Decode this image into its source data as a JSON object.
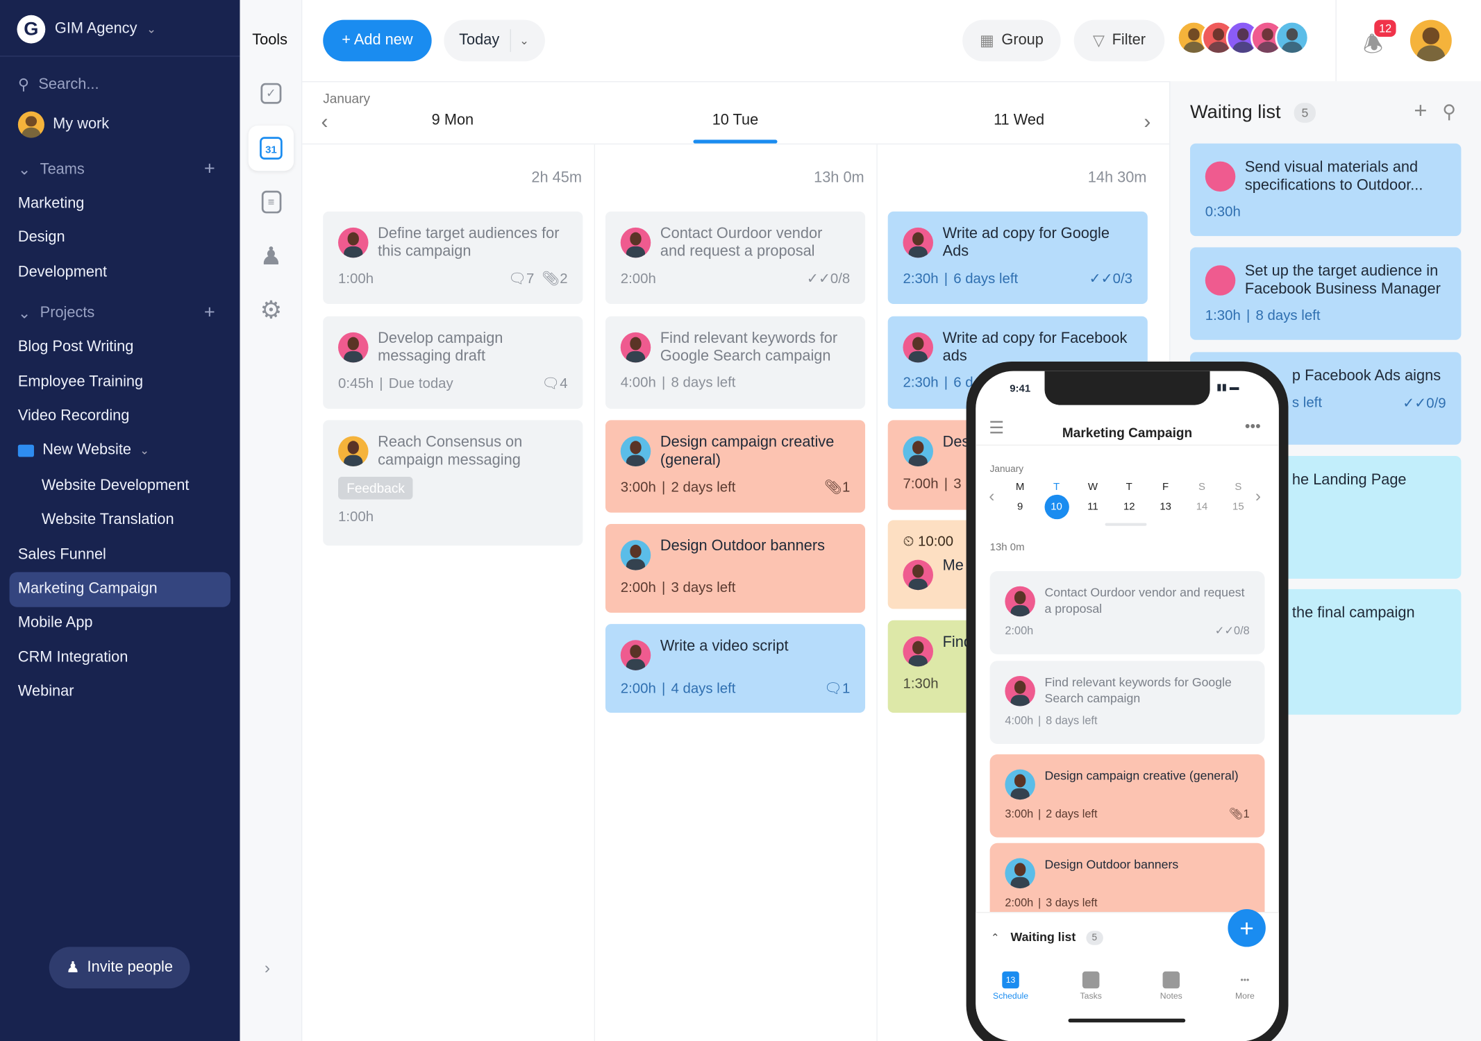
{
  "sidebar": {
    "workspace": "GIM Agency",
    "search_placeholder": "Search...",
    "my_work": "My work",
    "teams_label": "Teams",
    "teams": [
      "Marketing",
      "Design",
      "Development"
    ],
    "projects_label": "Projects",
    "projects": [
      "Blog Post Writing",
      "Employee Training",
      "Video Recording"
    ],
    "folder": "New Website",
    "folder_items": [
      "Website Development",
      "Website Translation"
    ],
    "projects_after": [
      "Sales Funnel",
      "Marketing Campaign",
      "Mobile App",
      "CRM Integration",
      "Webinar"
    ],
    "active_project": "Marketing Campaign",
    "invite": "Invite people"
  },
  "tools": {
    "label": "Tools",
    "calendar_day": "31",
    "icons": [
      "check-square-icon",
      "calendar-icon",
      "notes-icon",
      "person-icon",
      "gear-icon"
    ]
  },
  "header": {
    "add_new": "+ Add new",
    "today": "Today",
    "group": "Group",
    "filter": "Filter",
    "notification_count": "12"
  },
  "calendar": {
    "month": "January",
    "days": [
      {
        "label": "9 Mon",
        "total": "2h 45m",
        "cards": [
          {
            "title": "Define target audiences for this campaign",
            "time": "1:00h",
            "comments": "7",
            "attachments": "2",
            "color": "#f1f3f5",
            "faded": true,
            "avatar": "#ef5b8f"
          },
          {
            "title": "Develop campaign messaging draft",
            "time": "0:45h",
            "extra": "Due today",
            "comments": "4",
            "color": "#f1f3f5",
            "faded": true,
            "avatar": "#ef5b8f"
          },
          {
            "title": "Reach Consensus on campaign messaging",
            "tag": "Feedback",
            "time": "1:00h",
            "color": "#f1f3f5",
            "faded": true,
            "avatar": "#f5b33b"
          }
        ]
      },
      {
        "label": "10 Tue",
        "active": true,
        "total": "13h 0m",
        "cards": [
          {
            "title": "Contact Ourdoor vendor and request a proposal",
            "time": "2:00h",
            "checks": "0/8",
            "color": "#f1f3f5",
            "faded": true,
            "avatar": "#ef5b8f"
          },
          {
            "title": "Find relevant keywords for Google Search campaign",
            "time": "4:00h",
            "extra": "8 days left",
            "color": "#f1f3f5",
            "faded": true,
            "avatar": "#ef5b8f"
          },
          {
            "title": "Design campaign creative (general)",
            "time": "3:00h",
            "extra": "2 days left",
            "attachments": "1",
            "color": "#fcc3b1",
            "avatar": "#5bbde8"
          },
          {
            "title": "Design Outdoor banners",
            "time": "2:00h",
            "extra": "3 days left",
            "color": "#fcc3b1",
            "avatar": "#5bbde8"
          },
          {
            "title": "Write a video script",
            "time": "2:00h",
            "extra": "4 days left",
            "comments": "1",
            "color": "#b6dcfb",
            "avatar": "#ef5b8f"
          }
        ]
      },
      {
        "label": "11 Wed",
        "total": "14h 30m",
        "cards": [
          {
            "title": "Write ad copy for Google Ads",
            "time": "2:30h",
            "extra": "6 days left",
            "checks": "0/3",
            "color": "#b6dcfb",
            "avatar": "#ef5b8f"
          },
          {
            "title": "Write ad copy for Facebook ads",
            "time": "2:30h",
            "extra": "6 d",
            "color": "#b6dcfb",
            "avatar": "#ef5b8f"
          },
          {
            "title": "Des",
            "time": "7:00h",
            "extra": "3",
            "color": "#fcc3b1",
            "avatar": "#5bbde8"
          },
          {
            "title": "Me",
            "clock": "10:00",
            "color": "#fddfc2",
            "avatar": "#ef5b8f"
          },
          {
            "title": "Find com",
            "time": "1:30h",
            "color": "#dde8a8",
            "avatar": "#ef5b8f"
          }
        ]
      }
    ]
  },
  "waiting_list": {
    "title": "Waiting list",
    "count": "5",
    "items": [
      {
        "title": "Send visual materials and specifications to Outdoor...",
        "time": "0:30h",
        "color": "#b6dcfb"
      },
      {
        "title": "Set up the target audience in Facebook Business Manager",
        "time": "1:30h",
        "extra": "8 days left",
        "color": "#b6dcfb"
      },
      {
        "title": "p Facebook Ads aigns",
        "extra": "s left",
        "checks": "0/9",
        "color": "#b6dcfb"
      },
      {
        "title": "he Landing Page",
        "color": "#c2eefb"
      },
      {
        "title": "the final campaign",
        "color": "#c2eefb"
      }
    ]
  },
  "phone": {
    "time": "9:41",
    "title": "Marketing Campaign",
    "month": "January",
    "weekdays": [
      "M",
      "T",
      "W",
      "T",
      "F",
      "S",
      "S"
    ],
    "dates": [
      "9",
      "10",
      "11",
      "12",
      "13",
      "14",
      "15"
    ],
    "selected": "10",
    "total": "13h 0m",
    "cards": [
      {
        "title": "Contact Ourdoor vendor and request a proposal",
        "time": "2:00h",
        "checks": "0/8",
        "color": "#f1f3f5",
        "faded": true,
        "avatar": "#ef5b8f"
      },
      {
        "title": "Find relevant keywords for Google Search campaign",
        "time": "4:00h",
        "extra": "8 days left",
        "color": "#f1f3f5",
        "faded": true,
        "avatar": "#ef5b8f"
      },
      {
        "title": "Design campaign creative (general)",
        "time": "3:00h",
        "extra": "2 days left",
        "attachments": "1",
        "color": "#fcc3b1",
        "avatar": "#5bbde8"
      },
      {
        "title": "Design Outdoor banners",
        "time": "2:00h",
        "extra": "3 days left",
        "color": "#fcc3b1",
        "avatar": "#5bbde8"
      }
    ],
    "waiting_label": "Waiting list",
    "waiting_count": "5",
    "tabs": [
      {
        "label": "Schedule",
        "active": true,
        "badge": "13"
      },
      {
        "label": "Tasks"
      },
      {
        "label": "Notes"
      },
      {
        "label": "More"
      }
    ]
  },
  "colors": {
    "accent": "#1a8cf0",
    "sidebar": "#18234f",
    "badge": "#f0334a"
  }
}
